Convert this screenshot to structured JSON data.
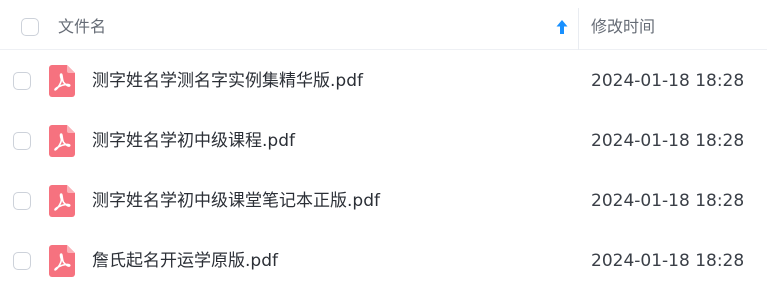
{
  "header": {
    "name_label": "文件名",
    "time_label": "修改时间",
    "sort_icon": "arrow-up-icon",
    "sort_direction": "ascending"
  },
  "files": [
    {
      "name": "测字姓名学测名字实例集精华版.pdf",
      "modified": "2024-01-18 18:28",
      "icon": "pdf-file-icon"
    },
    {
      "name": "测字姓名学初中级课程.pdf",
      "modified": "2024-01-18 18:28",
      "icon": "pdf-file-icon"
    },
    {
      "name": "测字姓名学初中级课堂笔记本正版.pdf",
      "modified": "2024-01-18 18:28",
      "icon": "pdf-file-icon"
    },
    {
      "name": "詹氏起名开运学原版.pdf",
      "modified": "2024-01-18 18:28",
      "icon": "pdf-file-icon"
    }
  ],
  "colors": {
    "accent": "#1890ff",
    "pdf_icon": "#f6727f",
    "divider": "#eef0f4",
    "header_text": "#666c76",
    "body_text": "#2b2f36"
  }
}
